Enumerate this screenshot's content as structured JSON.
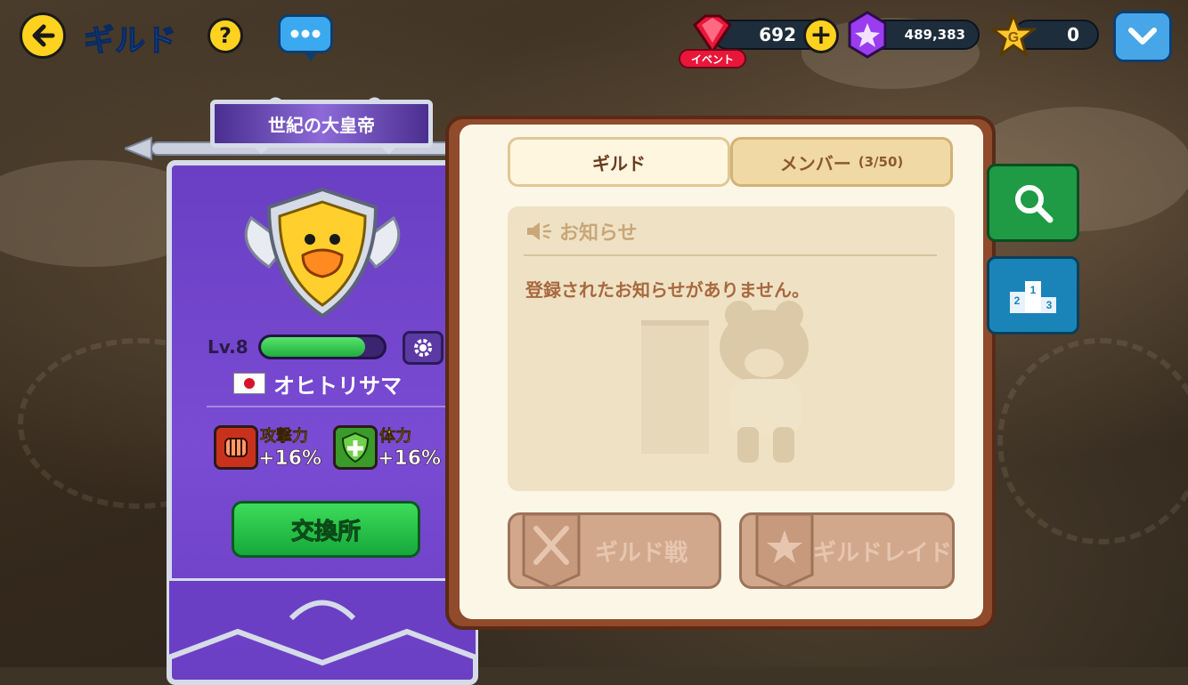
{
  "header": {
    "title": "ギルド",
    "help_label": "?"
  },
  "currencies": {
    "gems": "692",
    "event_label": "イベント",
    "purple": "489,383",
    "gold": "0",
    "plus_label": "+"
  },
  "guild": {
    "name": "世紀の大皇帝",
    "level_label": "Lv.8",
    "level_progress": 0.85,
    "master": "オヒトリサマ",
    "buffs": [
      {
        "name": "攻撃力",
        "value": "+16%"
      },
      {
        "name": "体力",
        "value": "+16%"
      }
    ],
    "exchange_label": "交換所"
  },
  "tabs": {
    "guild": "ギルド",
    "members": "メンバー",
    "members_count": "(3/50)"
  },
  "notice": {
    "title": "お知らせ",
    "message": "登録されたお知らせがありません。"
  },
  "actions": {
    "guild_war": "ギルド戦",
    "guild_raid": "ギルドレイド"
  },
  "colors": {
    "banner_purple": "#6a3fc3",
    "accent_yellow": "#ffd21f",
    "title_blue": "#2f7ee6",
    "level_green": "#2fcf52"
  },
  "icons": [
    "back-arrow-icon",
    "help-icon",
    "chat-icon",
    "gem-icon",
    "plus-icon",
    "purple-crystal-icon",
    "gold-star-icon",
    "chevron-down-icon",
    "settings-icon",
    "japan-flag-icon",
    "fist-icon",
    "health-cross-icon",
    "speaker-icon",
    "search-icon",
    "podium-icon",
    "swords-icon",
    "star-wings-icon"
  ]
}
